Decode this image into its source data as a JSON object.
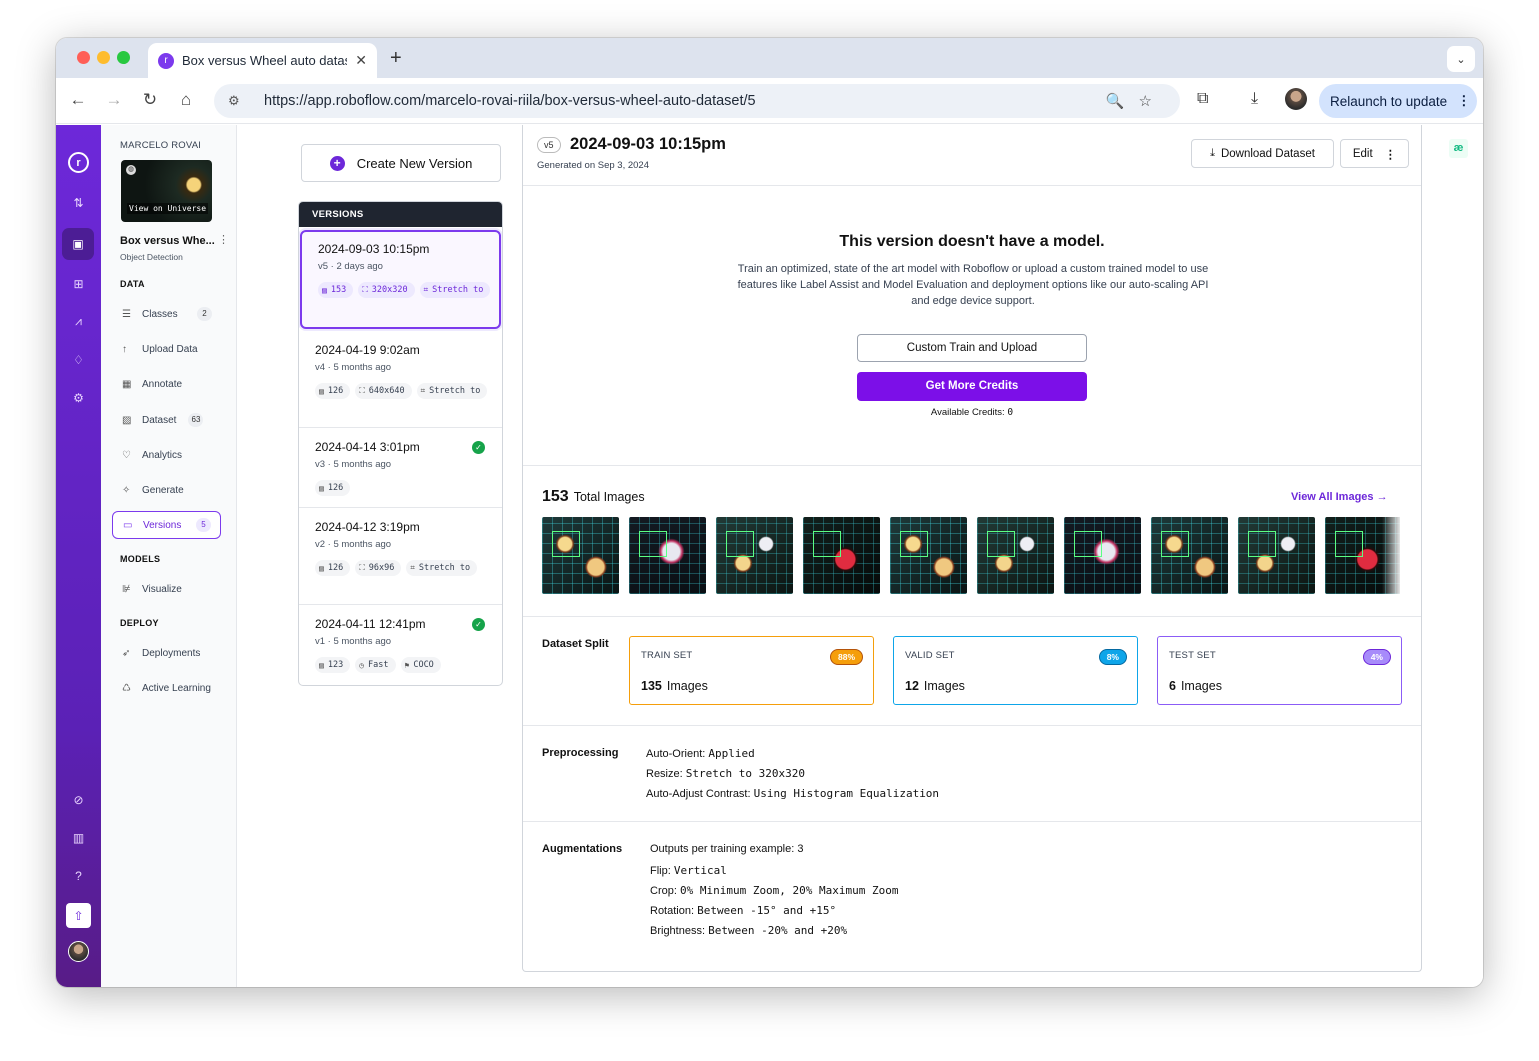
{
  "browser": {
    "tab_title": "Box versus Wheel auto datas…",
    "url": "https://app.roboflow.com/marcelo-rovai-riila/box-versus-wheel-auto-dataset/5",
    "relaunch_label": "Relaunch to update"
  },
  "sidebar": {
    "owner": "MARCELO ROVAI",
    "view_universe": "View on Universe",
    "project_name": "Box versus Whe...",
    "project_type": "Object Detection",
    "section_data": "DATA",
    "section_models": "MODELS",
    "section_deploy": "DEPLOY",
    "items": [
      {
        "label": "Classes",
        "count": "2"
      },
      {
        "label": "Upload Data",
        "count": ""
      },
      {
        "label": "Annotate",
        "count": ""
      },
      {
        "label": "Dataset",
        "count": "63"
      },
      {
        "label": "Analytics",
        "count": ""
      },
      {
        "label": "Generate",
        "count": ""
      },
      {
        "label": "Versions",
        "count": "5"
      },
      {
        "label": "Visualize",
        "count": ""
      },
      {
        "label": "Deployments",
        "count": ""
      },
      {
        "label": "Active Learning",
        "count": ""
      }
    ]
  },
  "versions_panel": {
    "create_label": "Create New Version",
    "header": "VERSIONS",
    "versions": [
      {
        "date": "2024-09-03 10:15pm",
        "meta": "v5 · 2 days ago",
        "chips": [
          "153",
          "320x320",
          "Stretch to"
        ],
        "trained": false
      },
      {
        "date": "2024-04-19 9:02am",
        "meta": "v4 · 5 months ago",
        "chips": [
          "126",
          "640x640",
          "Stretch to"
        ],
        "trained": false
      },
      {
        "date": "2024-04-14 3:01pm",
        "meta": "v3 · 5 months ago",
        "chips": [
          "126"
        ],
        "trained": true
      },
      {
        "date": "2024-04-12 3:19pm",
        "meta": "v2 · 5 months ago",
        "chips": [
          "126",
          "96x96",
          "Stretch to"
        ],
        "trained": false
      },
      {
        "date": "2024-04-11 12:41pm",
        "meta": "v1 · 5 months ago",
        "chips": [
          "123",
          "Fast",
          "COCO"
        ],
        "trained": true
      }
    ]
  },
  "main": {
    "version_pill": "v5",
    "title": "2024-09-03 10:15pm",
    "generated": "Generated on Sep 3, 2024",
    "download_label": "Download Dataset",
    "edit_label": "Edit",
    "no_model_title": "This version doesn't have a model.",
    "no_model_text": "Train an optimized, state of the art model with Roboflow or upload a custom trained model to use features like Label Assist and Model Evaluation and deployment options like our auto-scaling API and edge device support.",
    "custom_train_label": "Custom Train and Upload",
    "get_credits_label": "Get More Credits",
    "credits_label": "Available Credits:",
    "credits_value": "0",
    "total_images_count": "153",
    "total_images_label": "Total Images",
    "view_all_label": "View All Images",
    "dataset_split_label": "Dataset Split",
    "splits": [
      {
        "name": "TRAIN SET",
        "pct": "88%",
        "count": "135",
        "unit": "Images",
        "color": "#f59e0b"
      },
      {
        "name": "VALID SET",
        "pct": "8%",
        "count": "12",
        "unit": "Images",
        "color": "#0ea5e9"
      },
      {
        "name": "TEST SET",
        "pct": "4%",
        "count": "6",
        "unit": "Images",
        "color": "#8b5cf6"
      }
    ],
    "preprocessing_label": "Preprocessing",
    "preprocessing": [
      {
        "k": "Auto-Orient:",
        "v": "Applied"
      },
      {
        "k": "Resize:",
        "v": "Stretch to 320x320"
      },
      {
        "k": "Auto-Adjust Contrast:",
        "v": "Using Histogram Equalization"
      }
    ],
    "augmentations_label": "Augmentations",
    "augmentations": [
      {
        "k": "Outputs per training example: 3",
        "v": ""
      },
      {
        "k": "Flip:",
        "v": "Vertical"
      },
      {
        "k": "Crop:",
        "v": "0% Minimum Zoom, 20% Maximum Zoom"
      },
      {
        "k": "Rotation:",
        "v": "Between -15° and +15°"
      },
      {
        "k": "Brightness:",
        "v": "Between -20% and +20%"
      }
    ]
  }
}
